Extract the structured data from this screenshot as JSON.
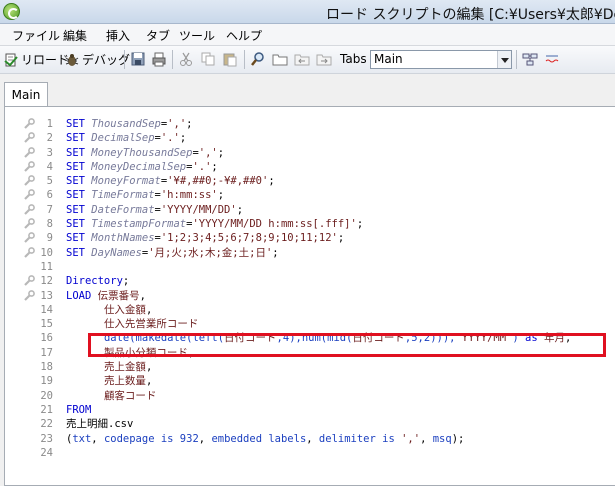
{
  "window": {
    "title": "ロード スクリプトの編集 [C:¥Users¥太郎¥Des"
  },
  "menu": {
    "items": [
      "ファイル",
      "編集",
      "挿入",
      "タブ",
      "ツール",
      "ヘルプ"
    ]
  },
  "toolbar": {
    "reload_label": "リロード",
    "debug_label": "デバッグ",
    "tabs_label": "Tabs",
    "tabs_select_value": "Main"
  },
  "tabs": {
    "active": "Main"
  },
  "editor": {
    "lines": [
      {
        "n": "1",
        "parts": [
          [
            "kw",
            "SET "
          ],
          [
            "var",
            "ThousandSep"
          ],
          [
            "blk",
            "="
          ],
          [
            "str",
            "','"
          ],
          [
            "blk",
            ";"
          ]
        ]
      },
      {
        "n": "2",
        "parts": [
          [
            "kw",
            "SET "
          ],
          [
            "var",
            "DecimalSep"
          ],
          [
            "blk",
            "="
          ],
          [
            "str",
            "'.'"
          ],
          [
            "blk",
            ";"
          ]
        ]
      },
      {
        "n": "3",
        "parts": [
          [
            "kw",
            "SET "
          ],
          [
            "var",
            "MoneyThousandSep"
          ],
          [
            "blk",
            "="
          ],
          [
            "str",
            "','"
          ],
          [
            "blk",
            ";"
          ]
        ]
      },
      {
        "n": "4",
        "parts": [
          [
            "kw",
            "SET "
          ],
          [
            "var",
            "MoneyDecimalSep"
          ],
          [
            "blk",
            "="
          ],
          [
            "str",
            "'.'"
          ],
          [
            "blk",
            ";"
          ]
        ]
      },
      {
        "n": "5",
        "parts": [
          [
            "kw",
            "SET "
          ],
          [
            "var",
            "MoneyFormat"
          ],
          [
            "blk",
            "="
          ],
          [
            "str",
            "'¥#,##0;-¥#,##0'"
          ],
          [
            "blk",
            ";"
          ]
        ]
      },
      {
        "n": "6",
        "parts": [
          [
            "kw",
            "SET "
          ],
          [
            "var",
            "TimeFormat"
          ],
          [
            "blk",
            "="
          ],
          [
            "str",
            "'h:mm:ss'"
          ],
          [
            "blk",
            ";"
          ]
        ]
      },
      {
        "n": "7",
        "parts": [
          [
            "kw",
            "SET "
          ],
          [
            "var",
            "DateFormat"
          ],
          [
            "blk",
            "="
          ],
          [
            "str",
            "'YYYY/MM/DD'"
          ],
          [
            "blk",
            ";"
          ]
        ]
      },
      {
        "n": "8",
        "parts": [
          [
            "kw",
            "SET "
          ],
          [
            "var",
            "TimestampFormat"
          ],
          [
            "blk",
            "="
          ],
          [
            "str",
            "'YYYY/MM/DD h:mm:ss[.fff]'"
          ],
          [
            "blk",
            ";"
          ]
        ]
      },
      {
        "n": "9",
        "parts": [
          [
            "kw",
            "SET "
          ],
          [
            "var",
            "MonthNames"
          ],
          [
            "blk",
            "="
          ],
          [
            "str",
            "'1;2;3;4;5;6;7;8;9;10;11;12'"
          ],
          [
            "blk",
            ";"
          ]
        ]
      },
      {
        "n": "10",
        "parts": [
          [
            "kw",
            "SET "
          ],
          [
            "var",
            "DayNames"
          ],
          [
            "blk",
            "="
          ],
          [
            "str",
            "'月;火;水;木;金;土;日'"
          ],
          [
            "blk",
            ";"
          ]
        ]
      },
      {
        "n": "11",
        "parts": []
      },
      {
        "n": "12",
        "parts": [
          [
            "kw",
            "Directory"
          ],
          [
            "blk",
            ";"
          ]
        ]
      },
      {
        "n": "13",
        "parts": [
          [
            "kw",
            "LOAD "
          ],
          [
            "fld",
            "伝票番号"
          ],
          [
            "blk",
            ","
          ]
        ]
      },
      {
        "n": "14",
        "parts": [
          [
            "blk",
            "      "
          ],
          [
            "fld",
            "仕入金額"
          ],
          [
            "blk",
            ","
          ]
        ]
      },
      {
        "n": "15",
        "parts": [
          [
            "blk",
            "      "
          ],
          [
            "fld",
            "仕入先営業所コード"
          ]
        ]
      },
      {
        "n": "16",
        "parts": [
          [
            "blk",
            "      "
          ],
          [
            "fn",
            "date(makedate(left("
          ],
          [
            "fld",
            "日付コード"
          ],
          [
            "fn",
            ",4),num(mid("
          ],
          [
            "fld",
            "日付コード"
          ],
          [
            "fn",
            ",5,2))),"
          ],
          [
            "str",
            "'YYYY/MM'"
          ],
          [
            "fn",
            ") "
          ],
          [
            "kw",
            "as "
          ],
          [
            "fld",
            "年月"
          ],
          [
            "blk",
            ","
          ]
        ]
      },
      {
        "n": "17",
        "parts": [
          [
            "blk",
            "      "
          ],
          [
            "fld",
            "製品小分類コード"
          ],
          [
            "blk",
            ","
          ]
        ]
      },
      {
        "n": "18",
        "parts": [
          [
            "blk",
            "      "
          ],
          [
            "fld",
            "売上金額"
          ],
          [
            "blk",
            ","
          ]
        ]
      },
      {
        "n": "19",
        "parts": [
          [
            "blk",
            "      "
          ],
          [
            "fld",
            "売上数量"
          ],
          [
            "blk",
            ","
          ]
        ]
      },
      {
        "n": "20",
        "parts": [
          [
            "blk",
            "      "
          ],
          [
            "fld",
            "顧客コード"
          ]
        ]
      },
      {
        "n": "21",
        "parts": [
          [
            "kw",
            "FROM"
          ]
        ]
      },
      {
        "n": "22",
        "parts": [
          [
            "blk",
            "売上明細.csv"
          ]
        ]
      },
      {
        "n": "23",
        "parts": [
          [
            "blk",
            "("
          ],
          [
            "fn",
            "txt"
          ],
          [
            "blk",
            ", "
          ],
          [
            "fn",
            "codepage is 932"
          ],
          [
            "blk",
            ", "
          ],
          [
            "fn",
            "embedded labels"
          ],
          [
            "blk",
            ", "
          ],
          [
            "fn",
            "delimiter is"
          ],
          [
            "blk",
            " "
          ],
          [
            "str",
            "','"
          ],
          [
            "blk",
            ", "
          ],
          [
            "fn",
            "msq"
          ],
          [
            "blk",
            ");"
          ]
        ]
      },
      {
        "n": "24",
        "parts": []
      }
    ]
  }
}
